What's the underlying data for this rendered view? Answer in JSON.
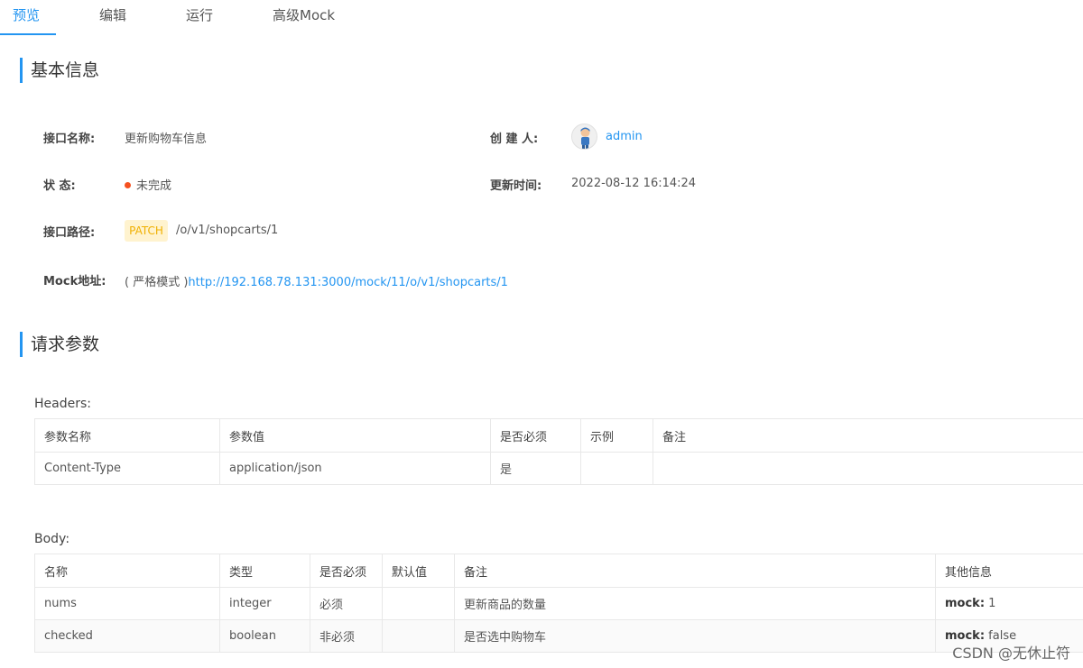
{
  "tabs": [
    {
      "label": "预览",
      "active": true
    },
    {
      "label": "编辑"
    },
    {
      "label": "运行"
    },
    {
      "label": "高级Mock"
    }
  ],
  "basic_info": {
    "title": "基本信息",
    "name_label": "接口名称:",
    "name_value": "更新购物车信息",
    "creator_label": "创 建 人:",
    "creator_value": "admin",
    "status_label": "状 态:",
    "status_value": "未完成",
    "update_time_label": "更新时间:",
    "update_time_value": "2022-08-12 16:14:24",
    "path_label": "接口路径:",
    "method": "PATCH",
    "path_value": "/o/v1/shopcarts/1",
    "mock_label": "Mock地址:",
    "mock_mode": "( 严格模式 )",
    "mock_url": "http://192.168.78.131:3000/mock/11/o/v1/shopcarts/1"
  },
  "request_params": {
    "title": "请求参数",
    "headers_title": "Headers:",
    "headers_columns": [
      "参数名称",
      "参数值",
      "是否必须",
      "示例",
      "备注"
    ],
    "headers_rows": [
      [
        "Content-Type",
        "application/json",
        "是",
        "",
        ""
      ]
    ],
    "body_title": "Body:",
    "body_columns": [
      "名称",
      "类型",
      "是否必须",
      "默认值",
      "备注",
      "其他信息"
    ],
    "body_rows": [
      {
        "name": "nums",
        "type": "integer",
        "required": "必须",
        "default": "",
        "note": "更新商品的数量",
        "mock_key": "mock:",
        "mock_val": "1"
      },
      {
        "name": "checked",
        "type": "boolean",
        "required": "非必须",
        "default": "",
        "note": "是否选中购物车",
        "mock_key": "mock:",
        "mock_val": "false"
      }
    ]
  },
  "watermark": "CSDN @无休止符",
  "colors": {
    "accent": "#2395f1",
    "status_dot": "#f5501f",
    "patch_bg": "#fff3cf",
    "patch_text": "#f0b000"
  }
}
